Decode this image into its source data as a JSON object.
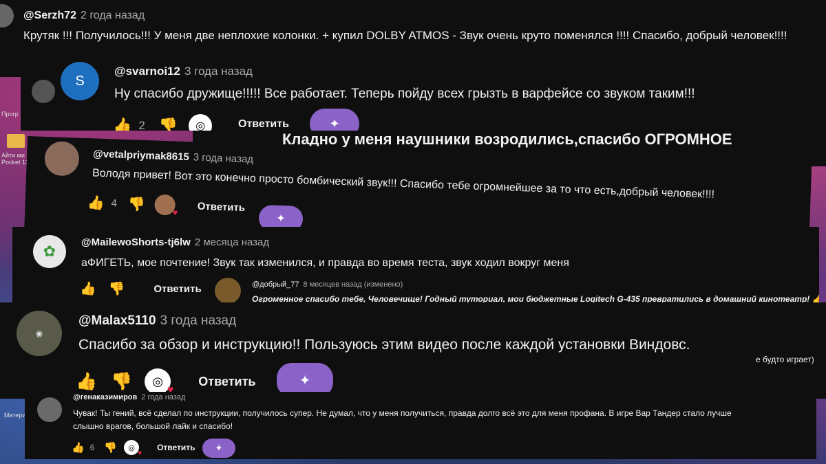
{
  "desktop": {
    "icon1": "Прогр",
    "icon2": "Айти ми\nPocket 13",
    "icon3": "Матери"
  },
  "c1": {
    "author": "@Serzh72",
    "time": "2 года назад",
    "text": "Крутяк !!! Получилось!!! У меня две неплохие колонки. + купил  DOLBY ATMOS -  Звук очень круто поменялся !!!! Спасибо, добрый человек!!!!"
  },
  "c2": {
    "avatar_letter": "S",
    "author": "@svarnoi12",
    "time": "3 года назад",
    "text": "Ну спасибо дружище!!!!! Все работает. Теперь пойду всех грызть в варфейсе со звуком таким!!!",
    "likes": "2",
    "reply": "Ответить"
  },
  "c2behind": {
    "text": "Кладно у меня наушники возродились,спасибо ОГРОМНОЕ"
  },
  "c3": {
    "author": "@vetalpriymak8615",
    "time": "3 года назад",
    "text": "Володя привет! Вот это конечно просто бомбический звук!!! Спасибо тебе огромнейшее за то что есть,добрый человек!!!!",
    "likes": "4",
    "reply": "Ответить"
  },
  "c4": {
    "author": "@MailewoShorts-tj6lw",
    "time": "2 месяца назад",
    "text": "аФИГЕТЬ, мое почтение!  Звук так изменился, и правда во время теста, звук ходил вокруг меня",
    "reply": "Ответить"
  },
  "c5": {
    "author": "@добрый_77",
    "time": "8 месяцев назад (изменено)",
    "text": "Огроменное спасибо тебе, Человечище! Годный туториал, мои бюджетные Logitech G-435 превратились в домашний кинотеатр! 👍"
  },
  "c6": {
    "author": "@Malax5110",
    "time": "3 года назад",
    "text": "Спасибо за обзор и инструкцию!! Пользуюсь этим видео после каждой установки Виндовс.",
    "reply": "Ответить",
    "behind_text": "е будто играет)"
  },
  "c7": {
    "author": "@генаказимиров",
    "time": "2 года назад",
    "text1": "Чувак! Ты гений, всё сделал по инструкции, получилось супер. Не думал, что у меня получиться, правда долго всё это для меня профана. В игре Вар Тандер стало лучше",
    "text2": "слышно врагов, большой лайк и спасибо!",
    "likes": "6",
    "reply": "Ответить"
  },
  "colors": {
    "bg": "#0f0f0f",
    "ai_button": "#8b63c8",
    "heart": "#e0244a",
    "muted": "#aaaaaa"
  }
}
